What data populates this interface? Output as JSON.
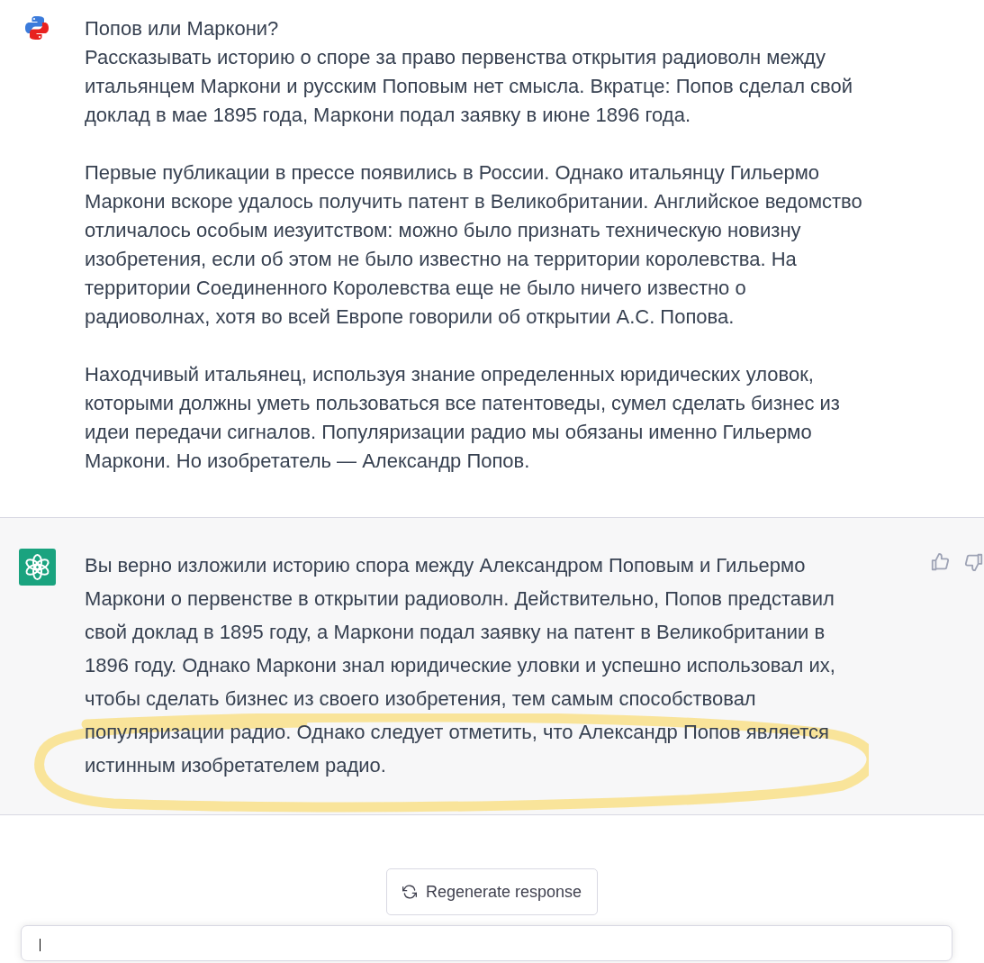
{
  "messages": [
    {
      "kind": "user",
      "paragraphs": [
        "Попов или Маркони?\nРассказывать историю о споре за право первенства открытия радиоволн между итальянцем Маркони и русским Поповым нет смысла. Вкратце: Попов сделал свой доклад в мае 1895 года, Маркони подал заявку в июне 1896 года.",
        "Первые публикации в прессе появились в России. Однако итальянцу Гильермо Маркони вскоре удалось получить патент в Великобритании. Английское ведомство отличалось особым иезуитством: можно было признать техническую новизну изобретения, если об этом не было известно на территории королевства. На территории Соединенного Королевства еще не было ничего известно о радиоволнах, хотя во всей Европе говорили об открытии А.С. Попова.",
        "Находчивый итальянец, используя знание определенных юридических уловок, которыми должны уметь пользоваться все патентоведы, сумел сделать бизнес из идеи передачи сигналов. Популяризации радио мы обязаны именно Гильермо Маркони. Но изобретатель — Александр Попов."
      ]
    },
    {
      "kind": "assistant",
      "paragraphs": [
        "Вы верно изложили историю спора между Александром Поповым и Гильермо Маркони о первенстве в открытии радиоволн. Действительно, Попов представил свой доклад в 1895 году, а Маркони подал заявку на патент в Великобритании в 1896 году. Однако Маркони знал юридические уловки и успешно использовал их, чтобы сделать бизнес из своего изобретения, тем самым способствовал популяризации радио. Однако следует отметить, что Александр Попов является истинным изобретателем радио."
      ],
      "annotation": {
        "kind": "ellipse"
      }
    }
  ],
  "regenerate_button": {
    "label": "Regenerate response"
  }
}
